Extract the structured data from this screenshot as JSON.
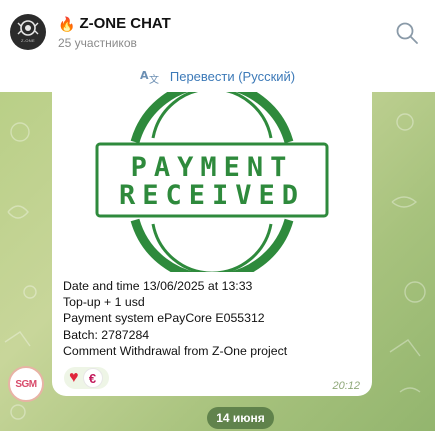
{
  "header": {
    "title": "Z-ONE CHAT",
    "subtitle": "25 участников",
    "avatar_caption": "Z-ONE",
    "title_icon": "fire-icon",
    "search_icon": "search-icon"
  },
  "translate": {
    "label": "Перевести (Русский)",
    "icon": "translate-icon"
  },
  "message": {
    "image": {
      "stamp_line1": "PAYMENT",
      "stamp_line2": "RECEIVED",
      "stamp_color": "#2e8a3c"
    },
    "lines": [
      "Date and time 13/06/2025 at 13:33",
      "Top-up + 1 usd",
      "Payment system ePayCore E055312",
      "Batch: 2787284",
      "Comment Withdrawal from Z-One project"
    ],
    "time": "20:12",
    "reactions": {
      "emoji": "♥",
      "reactor_letter": "€"
    },
    "sender_avatar_text": "SGM"
  },
  "date_separator": "14 июня",
  "colors": {
    "accent": "#3d7ab8",
    "chat_bg": "#b9cf87",
    "bubble": "#ffffff"
  }
}
